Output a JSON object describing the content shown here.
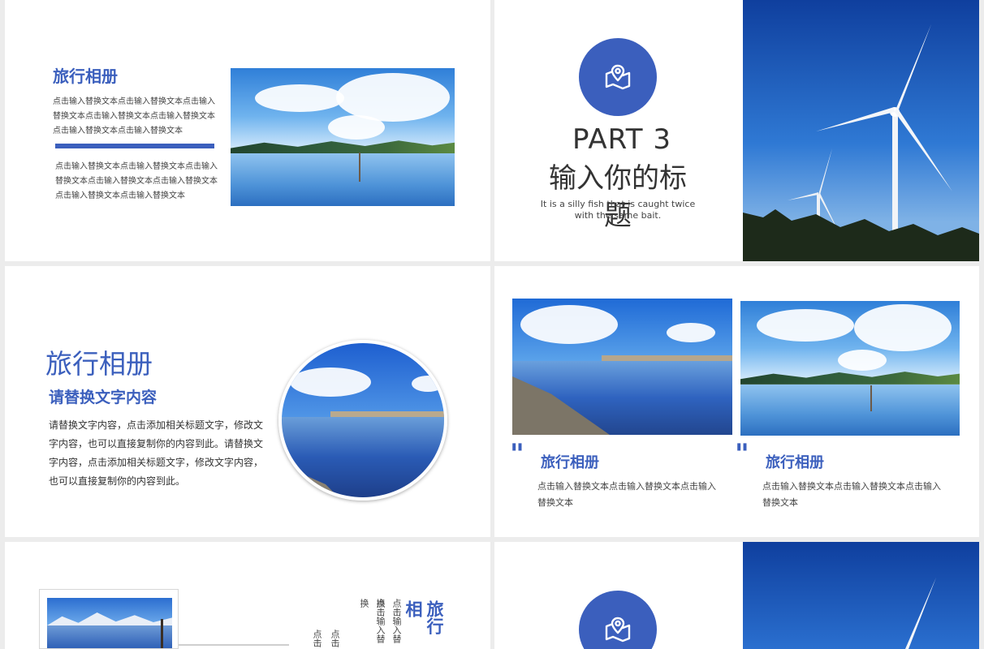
{
  "slide1": {
    "title": "旅行相册",
    "para1": "点击输入替换文本点击输入替换文本点击输入替换文本点击输入替换文本点击输入替换文本点击输入替换文本点击输入替换文本",
    "para2": "点击输入替换文本点击输入替换文本点击输入替换文本点击输入替换文本点击输入替换文本点击输入替换文本点击输入替换文本"
  },
  "slide2": {
    "part": "PART 3",
    "title": "输入你的标题",
    "subtitle": "It is a silly fish that is caught twice with the same bait."
  },
  "slide3": {
    "title": "旅行相册",
    "subtitle": "请替换文字内容",
    "body": "请替换文字内容，点击添加相关标题文字，修改文字内容，也可以直接复制你的内容到此。请替换文字内容，点击添加相关标题文字，修改文字内容，也可以直接复制你的内容到此。"
  },
  "slide4": {
    "quote_mark": "\"",
    "card1_title": "旅行相册",
    "card1_text": "点击输入替换文本点击输入替换文本点击输入替换文本",
    "card2_title": "旅行相册",
    "card2_text": "点击输入替换文本点击输入替换文本点击输入替换文本"
  },
  "slide5": {
    "vtitle": "旅行相",
    "vtext1": "点击输入替换",
    "vtext2": "点击输入替换",
    "vtext3": "点击",
    "vtext4": "点击"
  },
  "colors": {
    "accent": "#3b5fbd",
    "text": "#444444"
  },
  "icons": {
    "badge": "map-location-icon"
  }
}
